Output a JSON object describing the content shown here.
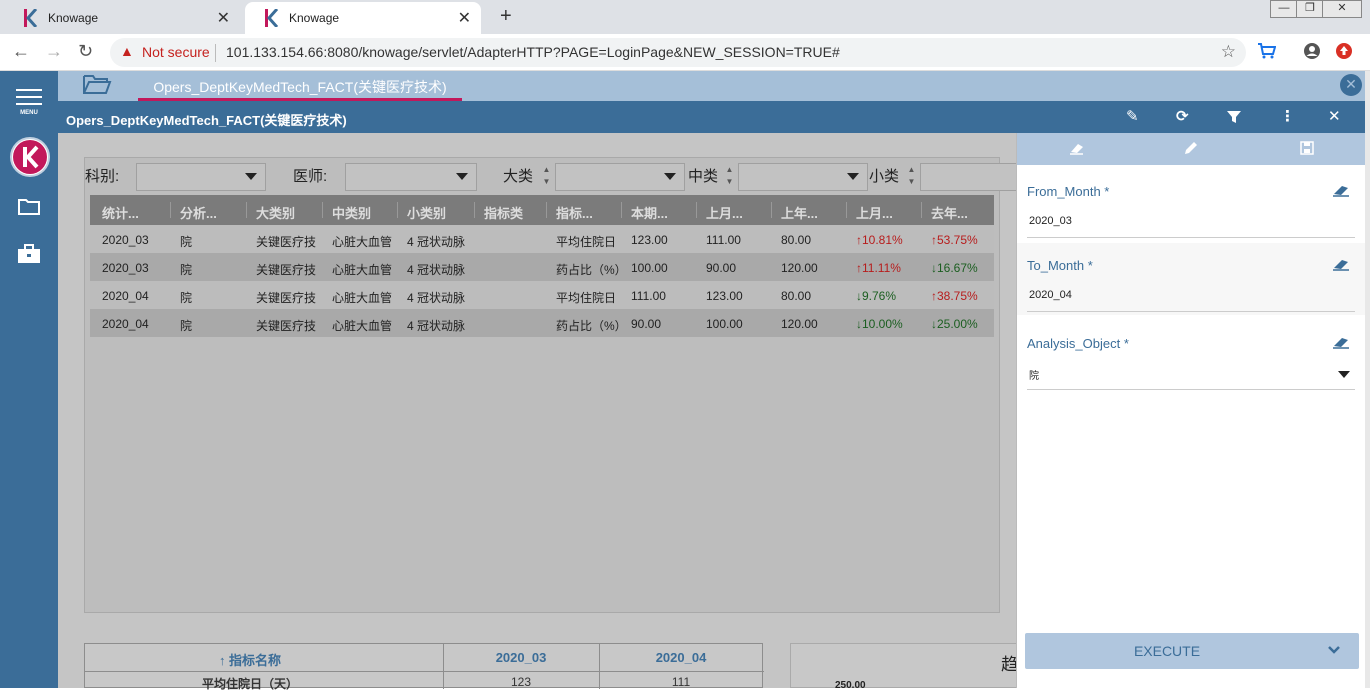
{
  "browser": {
    "tabs": [
      {
        "title": "Knowage",
        "close": "✕"
      },
      {
        "title": "Knowage",
        "close": "✕"
      }
    ],
    "new_tab": "+",
    "back": "←",
    "forward": "→",
    "reload": "↻",
    "security_label": "Not secure",
    "url": "101.133.154.66:8080/knowage/servlet/AdapterHTTP?PAGE=LoginPage&NEW_SESSION=TRUE#",
    "window_controls": [
      "—",
      "❐",
      "✕"
    ]
  },
  "sidebar": {
    "menu_label": "MENU",
    "items": [
      "menu-icon",
      "knowage-logo",
      "folder-icon",
      "briefcase-icon"
    ]
  },
  "document": {
    "tab_title": "Opers_DeptKeyMedTech_FACT(关键医疗技术)",
    "title": "Opers_DeptKeyMedTech_FACT(关键医疗技术)",
    "toolbar_icons": [
      "edit-icon",
      "refresh-icon",
      "filter-icon",
      "more-icon",
      "close-icon"
    ]
  },
  "filters": [
    {
      "label": "科别:",
      "value": ""
    },
    {
      "label": "医师:",
      "value": ""
    },
    {
      "label": "大类别",
      "value": ""
    },
    {
      "label": "中类别",
      "value": ""
    },
    {
      "label": "小类别",
      "value": ""
    }
  ],
  "grid": {
    "columns": [
      "统计...",
      "分析...",
      "大类别",
      "中类别",
      "小类别",
      "指标类",
      "指标...",
      "本期...",
      "上月...",
      "上年...",
      "上月...",
      "去年..."
    ],
    "rows": [
      [
        "2020_03",
        "院",
        "关键医疗技",
        "心脏大血管",
        "4 冠状动脉",
        "",
        "平均住院日",
        "123.00",
        "111.00",
        "80.00",
        "↑10.81%",
        "↑53.75%"
      ],
      [
        "2020_03",
        "院",
        "关键医疗技",
        "心脏大血管",
        "4 冠状动脉",
        "",
        "药占比（%）",
        "100.00",
        "90.00",
        "120.00",
        "↑11.11%",
        "↓16.67%"
      ],
      [
        "2020_04",
        "院",
        "关键医疗技",
        "心脏大血管",
        "4 冠状动脉",
        "",
        "平均住院日",
        "111.00",
        "123.00",
        "80.00",
        "↓9.76%",
        "↑38.75%"
      ],
      [
        "2020_04",
        "院",
        "关键医疗技",
        "心脏大血管",
        "4 冠状动脉",
        "",
        "药占比（%）",
        "90.00",
        "100.00",
        "120.00",
        "↓10.00%",
        "↓25.00%"
      ]
    ],
    "trend_colors": {
      "up": "#b71c1c",
      "down": "#1b5e20"
    }
  },
  "bottom_table": {
    "headers": [
      "↑ 指标名称",
      "2020_03",
      "2020_04"
    ],
    "first_row": [
      "平均住院日（天）",
      "123",
      "111"
    ]
  },
  "trend_panel": {
    "title": "趋",
    "partial_value": "250.00"
  },
  "parameters": {
    "panel_icons": [
      "eraser-icon",
      "pencil-icon",
      "save-icon"
    ],
    "items": [
      {
        "label": "From_Month *",
        "value": "2020_03"
      },
      {
        "label": "To_Month *",
        "value": "2020_04"
      },
      {
        "label": "Analysis_Object *",
        "value": "院"
      }
    ],
    "execute_label": "EXECUTE",
    "execute_arrow": "⌄"
  },
  "colors": {
    "brand_blue": "#3b6d98",
    "light_blue": "#a5bfd8",
    "accent_pink": "#c2185b"
  }
}
